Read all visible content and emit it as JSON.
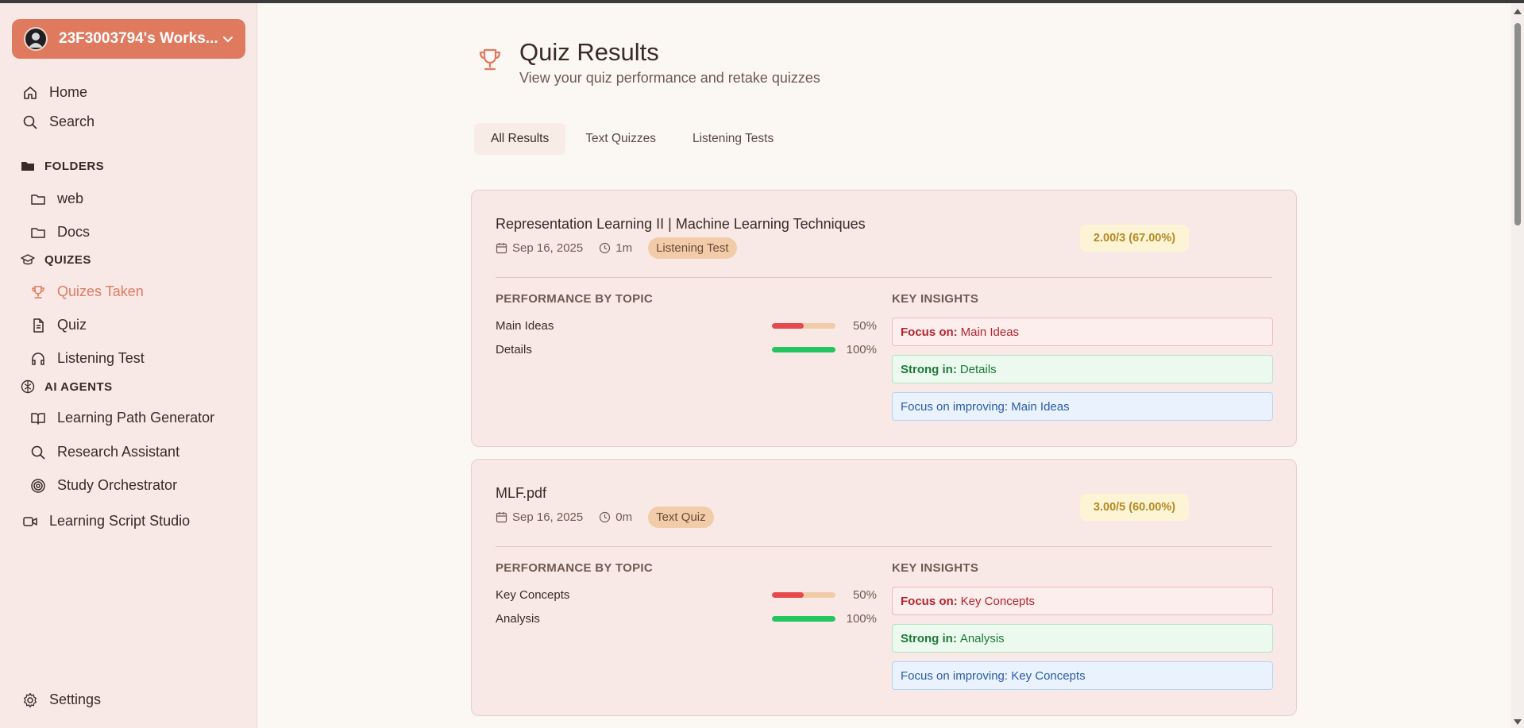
{
  "workspace": {
    "name": "23F3003794's Works..."
  },
  "sidebar": {
    "home": "Home",
    "search": "Search",
    "folders_label": "FOLDERS",
    "folders": [
      "web",
      "Docs"
    ],
    "quizzes_label": "QUIZES",
    "quizzes": [
      "Quizes Taken",
      "Quiz",
      "Listening Test"
    ],
    "agents_label": "AI AGENTS",
    "agents": [
      "Learning Path Generator",
      "Research Assistant",
      "Study Orchestrator"
    ],
    "studio": "Learning Script Studio",
    "settings": "Settings"
  },
  "header": {
    "title": "Quiz Results",
    "subtitle": "View your quiz performance and retake quizzes"
  },
  "tabs": [
    "All Results",
    "Text Quizzes",
    "Listening Tests"
  ],
  "labels": {
    "performance": "PERFORMANCE BY TOPIC",
    "insights": "KEY INSIGHTS"
  },
  "results": [
    {
      "title": "Representation Learning II | Machine Learning Techniques",
      "date": "Sep 16, 2025",
      "duration": "1m",
      "type": "Listening Test",
      "score": "2.00/3 (67.00%)",
      "topics": [
        {
          "name": "Main Ideas",
          "pct": "50%",
          "value": 0.5
        },
        {
          "name": "Details",
          "pct": "100%",
          "value": 1.0
        }
      ],
      "insights": {
        "focus_label": "Focus on:",
        "focus": "Main Ideas",
        "strong_label": "Strong in:",
        "strong": "Details",
        "improve": "Focus on improving: Main Ideas"
      }
    },
    {
      "title": "MLF.pdf",
      "date": "Sep 16, 2025",
      "duration": "0m",
      "type": "Text Quiz",
      "score": "3.00/5 (60.00%)",
      "topics": [
        {
          "name": "Key Concepts",
          "pct": "50%",
          "value": 0.5
        },
        {
          "name": "Analysis",
          "pct": "100%",
          "value": 1.0
        }
      ],
      "insights": {
        "focus_label": "Focus on:",
        "focus": "Key Concepts",
        "strong_label": "Strong in:",
        "strong": "Analysis",
        "improve": "Focus on improving: Key Concepts"
      }
    }
  ],
  "colors": {
    "accent": "#e07a5f",
    "bar_low": "#e5484d",
    "bar_high": "#22c55e"
  }
}
